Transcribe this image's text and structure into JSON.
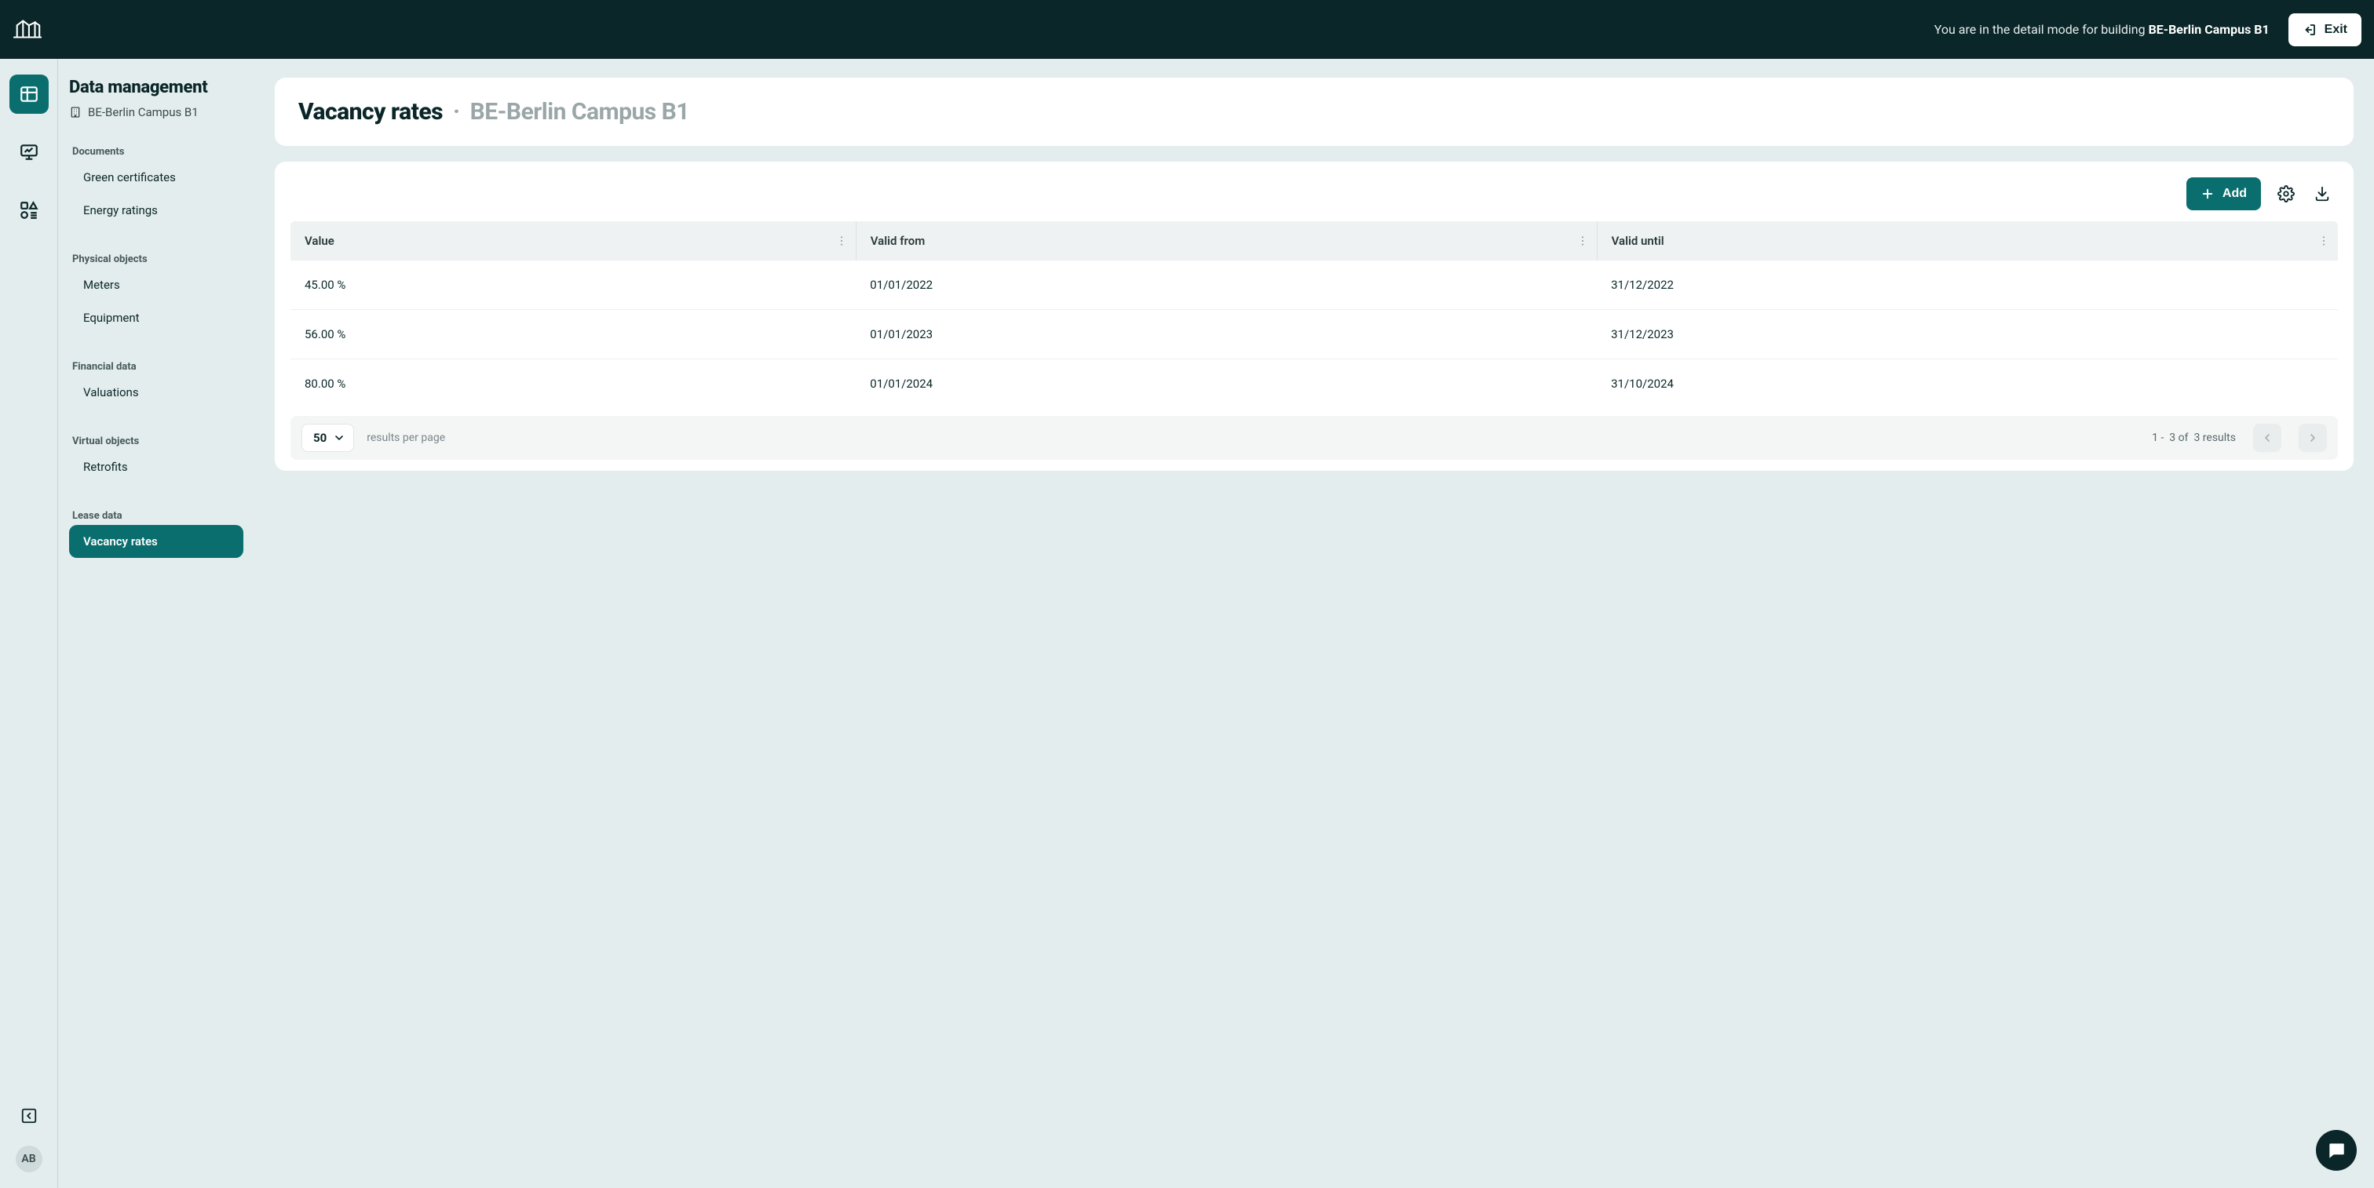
{
  "header": {
    "mode_prefix": "You are in the detail mode for building ",
    "building_name": "BE-Berlin Campus B1",
    "exit_label": "Exit"
  },
  "rail": {
    "avatar_initials": "AB"
  },
  "sidebar": {
    "title": "Data management",
    "building_label": "BE-Berlin Campus B1",
    "sections": [
      {
        "label": "Documents",
        "items": [
          "Green certificates",
          "Energy ratings"
        ]
      },
      {
        "label": "Physical objects",
        "items": [
          "Meters",
          "Equipment"
        ]
      },
      {
        "label": "Financial data",
        "items": [
          "Valuations"
        ]
      },
      {
        "label": "Virtual objects",
        "items": [
          "Retrofits"
        ]
      },
      {
        "label": "Lease data",
        "items": [
          "Vacancy rates"
        ]
      }
    ],
    "active_item": "Vacancy rates"
  },
  "page": {
    "title": "Vacancy rates",
    "subtitle": "BE-Berlin Campus B1",
    "add_label": "Add"
  },
  "table": {
    "columns": [
      "Value",
      "Valid from",
      "Valid until"
    ],
    "rows": [
      {
        "value": "45.00 %",
        "from": "01/01/2022",
        "until": "31/12/2022"
      },
      {
        "value": "56.00 %",
        "from": "01/01/2023",
        "until": "31/12/2023"
      },
      {
        "value": "80.00 %",
        "from": "01/01/2024",
        "until": "31/10/2024"
      }
    ]
  },
  "pagination": {
    "page_size": "50",
    "per_page_label": "results per page",
    "range_from": "1",
    "range_to": "3",
    "of_label": "of",
    "total": "3",
    "results_label": "results"
  }
}
